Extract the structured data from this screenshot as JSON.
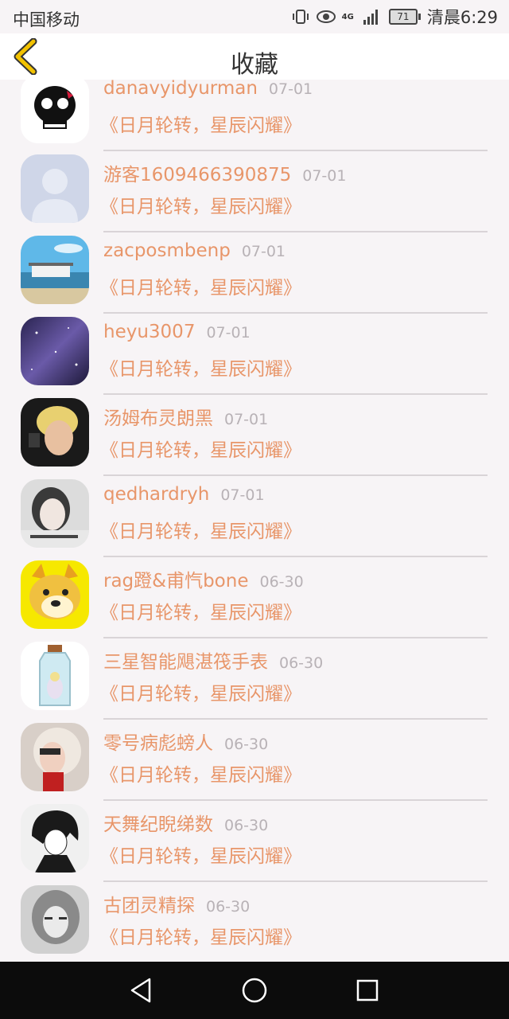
{
  "status_bar": {
    "carrier": "中国移动",
    "network": "4G",
    "battery": "71",
    "time": "清晨6:29"
  },
  "header": {
    "title": "收藏",
    "back_icon": "chevron-left-icon",
    "accent": "#f2c200"
  },
  "colors": {
    "name": "#e8966a",
    "date": "#b8b2b6",
    "background": "#f7f4f6"
  },
  "items": [
    {
      "name": "danavyidyurman",
      "date": "07-01",
      "book": "《日月轮转，星辰闪耀》",
      "avatar": "skull-avatar"
    },
    {
      "name": "游客1609466390875",
      "date": "07-01",
      "book": "《日月轮转，星辰闪耀》",
      "avatar": "default-person-avatar"
    },
    {
      "name": "zacposmbenp",
      "date": "07-01",
      "book": "《日月轮转，星辰闪耀》",
      "avatar": "beach-house-avatar"
    },
    {
      "name": "heyu3007",
      "date": "07-01",
      "book": "《日月轮转，星辰闪耀》",
      "avatar": "galaxy-avatar"
    },
    {
      "name": "汤姆布灵朗黑",
      "date": "07-01",
      "book": "《日月轮转，星辰闪耀》",
      "avatar": "blond-person-avatar"
    },
    {
      "name": "qedhardryh",
      "date": "07-01",
      "book": "《日月轮转，星辰闪耀》",
      "avatar": "girl-photo-avatar"
    },
    {
      "name": "rag蹬&甫忾bone",
      "date": "06-30",
      "book": "《日月轮转，星辰闪耀》",
      "avatar": "doge-avatar"
    },
    {
      "name": "三星智能飓湛筏手表",
      "date": "06-30",
      "book": "《日月轮转，星辰闪耀》",
      "avatar": "bottle-avatar"
    },
    {
      "name": "零号病彪螃人",
      "date": "06-30",
      "book": "《日月轮转，星辰闪耀》",
      "avatar": "redhead-avatar"
    },
    {
      "name": "天舞纪睨绨数",
      "date": "06-30",
      "book": "《日月轮转，星辰闪耀》",
      "avatar": "anime-boy-avatar"
    },
    {
      "name": "古团灵精探",
      "date": "06-30",
      "book": "《日月轮转，星辰闪耀》",
      "avatar": "bw-girl-avatar"
    }
  ],
  "nav": {
    "back": "triangle-back-icon",
    "home": "circle-home-icon",
    "recents": "square-recents-icon"
  }
}
